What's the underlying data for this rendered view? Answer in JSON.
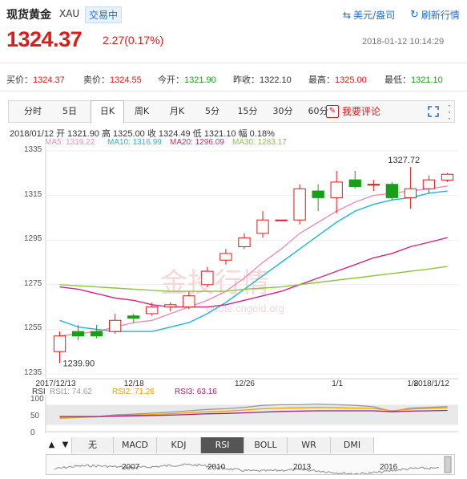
{
  "header": {
    "title": "现货黄金",
    "code": "XAU",
    "status": "交易中",
    "unit_button": "美元/盎司",
    "refresh_button": "刷新行情",
    "price": "1324.37",
    "change": "2.27(0.17%)",
    "timestamp": "2018-01-12 10:14:29"
  },
  "quotes": [
    {
      "label": "买价：",
      "value": "1324.37",
      "color": "red"
    },
    {
      "label": "卖价：",
      "value": "1324.55",
      "color": "red"
    },
    {
      "label": "今开：",
      "value": "1321.90",
      "color": "green"
    },
    {
      "label": "昨收：",
      "value": "1322.10",
      "color": "normal"
    },
    {
      "label": "最高：",
      "value": "1325.00",
      "color": "red"
    },
    {
      "label": "最低：",
      "value": "1321.10",
      "color": "green"
    }
  ],
  "tabs": [
    "分时",
    "5日",
    "日K",
    "周K",
    "月K",
    "5分",
    "15分",
    "30分",
    "60分"
  ],
  "active_tab": "日K",
  "comment_button": "我要评论",
  "ohlc_line": "2018/01/12  开 1321.90  高 1325.00  收 1324.49  低 1321.10  幅 0.18%",
  "ma_legend": [
    {
      "label": "MA5: 1319.22",
      "color": "#f08cb4"
    },
    {
      "label": "MA10: 1316.99",
      "color": "#1fb6d6"
    },
    {
      "label": "MA20: 1296.09",
      "color": "#d6247a"
    },
    {
      "label": "MA30: 1283.17",
      "color": "#8fc33b"
    }
  ],
  "rsi_legend": {
    "title": "RSI",
    "items": [
      {
        "label": "RSI1: 74.62",
        "color": "#999999"
      },
      {
        "label": "RSI2: 71.26",
        "color": "#f0a000"
      },
      {
        "label": "RSI3: 63.16",
        "color": "#a0207a"
      }
    ]
  },
  "indicator_buttons": [
    "无",
    "MACD",
    "KDJ",
    "RSI",
    "BOLL",
    "WR",
    "DMI"
  ],
  "active_indicator": "RSI",
  "navigator_years": [
    "2007",
    "2010",
    "2013",
    "2016"
  ],
  "watermark": "金投行情",
  "watermark_url": "quote.cngold.org",
  "chart_data": {
    "type": "candlestick",
    "y_ticks": [
      1335,
      1315,
      1295,
      1275,
      1255,
      1235
    ],
    "ylim": [
      1235,
      1335
    ],
    "x_ticks": [
      "2017/12/13",
      "12/18",
      "12/26",
      "1/1",
      "1/8",
      "2018/1/12"
    ],
    "annotations": [
      "1327.72",
      "1239.90"
    ],
    "candles": [
      {
        "o": 1245,
        "c": 1252,
        "h": 1254,
        "l": 1239.9
      },
      {
        "o": 1254,
        "c": 1252,
        "h": 1257,
        "l": 1250
      },
      {
        "o": 1254,
        "c": 1252,
        "h": 1257,
        "l": 1251
      },
      {
        "o": 1254,
        "c": 1259,
        "h": 1262,
        "l": 1253
      },
      {
        "o": 1261,
        "c": 1260,
        "h": 1262,
        "l": 1258
      },
      {
        "o": 1262,
        "c": 1265,
        "h": 1267,
        "l": 1261
      },
      {
        "o": 1265,
        "c": 1266,
        "h": 1267,
        "l": 1263
      },
      {
        "o": 1265,
        "c": 1270,
        "h": 1272,
        "l": 1264
      },
      {
        "o": 1275,
        "c": 1281,
        "h": 1283,
        "l": 1274
      },
      {
        "o": 1286,
        "c": 1289,
        "h": 1291,
        "l": 1284
      },
      {
        "o": 1292,
        "c": 1296,
        "h": 1298,
        "l": 1291
      },
      {
        "o": 1298,
        "c": 1304,
        "h": 1308,
        "l": 1296
      },
      {
        "o": 1304,
        "c": 1304,
        "h": 1304,
        "l": 1304
      },
      {
        "o": 1304,
        "c": 1318,
        "h": 1320,
        "l": 1302
      },
      {
        "o": 1317,
        "c": 1314,
        "h": 1320,
        "l": 1308
      },
      {
        "o": 1314,
        "c": 1321,
        "h": 1326,
        "l": 1307
      },
      {
        "o": 1322,
        "c": 1319,
        "h": 1326,
        "l": 1318
      },
      {
        "o": 1320,
        "c": 1320,
        "h": 1322,
        "l": 1317
      },
      {
        "o": 1320,
        "c": 1314,
        "h": 1321,
        "l": 1313
      },
      {
        "o": 1314,
        "c": 1318,
        "h": 1327.72,
        "l": 1309
      },
      {
        "o": 1318,
        "c": 1322,
        "h": 1324,
        "l": 1316
      },
      {
        "o": 1321.9,
        "c": 1324.49,
        "h": 1325,
        "l": 1321.1
      }
    ],
    "series": [
      {
        "name": "MA5",
        "color": "#f08cb4",
        "values": [
          1252,
          1253,
          1254,
          1256,
          1258,
          1259,
          1262,
          1265,
          1268,
          1272,
          1278,
          1285,
          1291,
          1298,
          1303,
          1308,
          1312,
          1315,
          1316,
          1317,
          1318,
          1319.22
        ]
      },
      {
        "name": "MA10",
        "color": "#1fb6d6",
        "values": [
          1259,
          1256,
          1255,
          1254,
          1254,
          1254,
          1256,
          1258,
          1262,
          1267,
          1273,
          1279,
          1285,
          1291,
          1297,
          1303,
          1308,
          1311,
          1313,
          1314,
          1316,
          1316.99
        ]
      },
      {
        "name": "MA20",
        "color": "#d6247a",
        "values": [
          1274,
          1273,
          1271,
          1269,
          1268,
          1266,
          1265,
          1265,
          1265,
          1266,
          1268,
          1270,
          1272,
          1275,
          1278,
          1281,
          1284,
          1287,
          1289,
          1292,
          1294,
          1296.09
        ]
      },
      {
        "name": "MA30",
        "color": "#8fc33b",
        "values": [
          1275,
          1274.5,
          1274,
          1273.5,
          1273,
          1272.5,
          1272,
          1272,
          1272,
          1272,
          1273,
          1273.5,
          1274,
          1275,
          1276,
          1277,
          1278,
          1279,
          1280,
          1281,
          1282,
          1283.17
        ]
      }
    ],
    "rsi": {
      "ylim": [
        0,
        100
      ],
      "y_ticks": [
        100,
        50,
        0
      ],
      "series": [
        {
          "name": "RSI1",
          "color": "#999999",
          "values": [
            40,
            42,
            44,
            50,
            52,
            55,
            58,
            62,
            66,
            68,
            72,
            78,
            80,
            80,
            82,
            80,
            78,
            74,
            60,
            70,
            72,
            74.62
          ]
        },
        {
          "name": "RSI2",
          "color": "#f0a000",
          "values": [
            42,
            43,
            44,
            47,
            49,
            51,
            53,
            56,
            59,
            61,
            64,
            68,
            70,
            71,
            72,
            71,
            70,
            69,
            62,
            67,
            69,
            71.26
          ]
        },
        {
          "name": "RSI3",
          "color": "#a0207a",
          "values": [
            45,
            45,
            45,
            46,
            47,
            48,
            49,
            51,
            53,
            54,
            56,
            58,
            60,
            61,
            62,
            62,
            62,
            62,
            59,
            61,
            62,
            63.16
          ]
        }
      ]
    }
  }
}
